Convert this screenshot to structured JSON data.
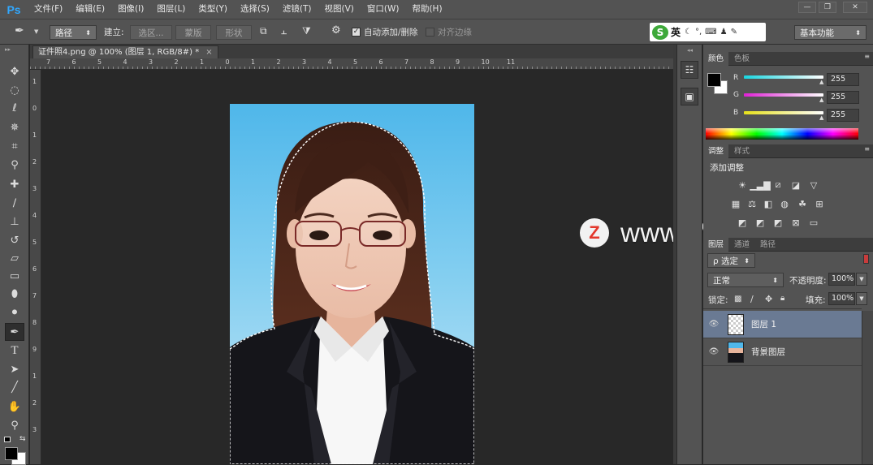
{
  "app": {
    "logo": "Ps"
  },
  "menu": [
    "文件(F)",
    "编辑(E)",
    "图像(I)",
    "图层(L)",
    "类型(Y)",
    "选择(S)",
    "滤镜(T)",
    "视图(V)",
    "窗口(W)",
    "帮助(H)"
  ],
  "window_buttons": [
    "—",
    "❐",
    "✕"
  ],
  "options": {
    "mode": "路径",
    "make_label": "建立:",
    "selection_btn": "选区...",
    "mask_btn": "蒙版",
    "shape_btn": "形状",
    "auto_add_label": "自动添加/删除",
    "align_edges_label": "对齐边缘",
    "workspace": "基本功能"
  },
  "ime": {
    "logo": "S",
    "lang": "英"
  },
  "document": {
    "tab_title": "证件照4.png @ 100% (图层 1, RGB/8#) *",
    "hruler_labels": [
      "7",
      "6",
      "5",
      "4",
      "3",
      "2",
      "1",
      "0",
      "1",
      "2",
      "3",
      "4",
      "5",
      "6",
      "7",
      "8",
      "9",
      "10",
      "11"
    ],
    "vruler_labels": [
      "1",
      "0",
      "1",
      "2",
      "3",
      "4",
      "5",
      "6",
      "7",
      "8",
      "9",
      "1",
      "2",
      "3"
    ]
  },
  "color_panel": {
    "tabs": [
      "颜色",
      "色板"
    ],
    "channels": [
      {
        "label": "R",
        "value": "255",
        "color": "#19d6e0"
      },
      {
        "label": "G",
        "value": "255",
        "color": "#e020d6"
      },
      {
        "label": "B",
        "value": "255",
        "color": "#e6e01a"
      }
    ]
  },
  "adjust_panel": {
    "tabs": [
      "调整",
      "样式"
    ],
    "title": "添加调整"
  },
  "layers_panel": {
    "tabs": [
      "图层",
      "通道",
      "路径"
    ],
    "filter": "ρ 选定",
    "blend_mode": "正常",
    "opacity_label": "不透明度:",
    "opacity_value": "100%",
    "lock_label": "锁定:",
    "fill_label": "填充:",
    "fill_value": "100%",
    "layers": [
      {
        "name": "图层 1",
        "selected": true
      },
      {
        "name": "背景图层",
        "selected": false
      }
    ]
  },
  "watermark": {
    "logo": "Z",
    "text": "www.MacZ.com"
  }
}
